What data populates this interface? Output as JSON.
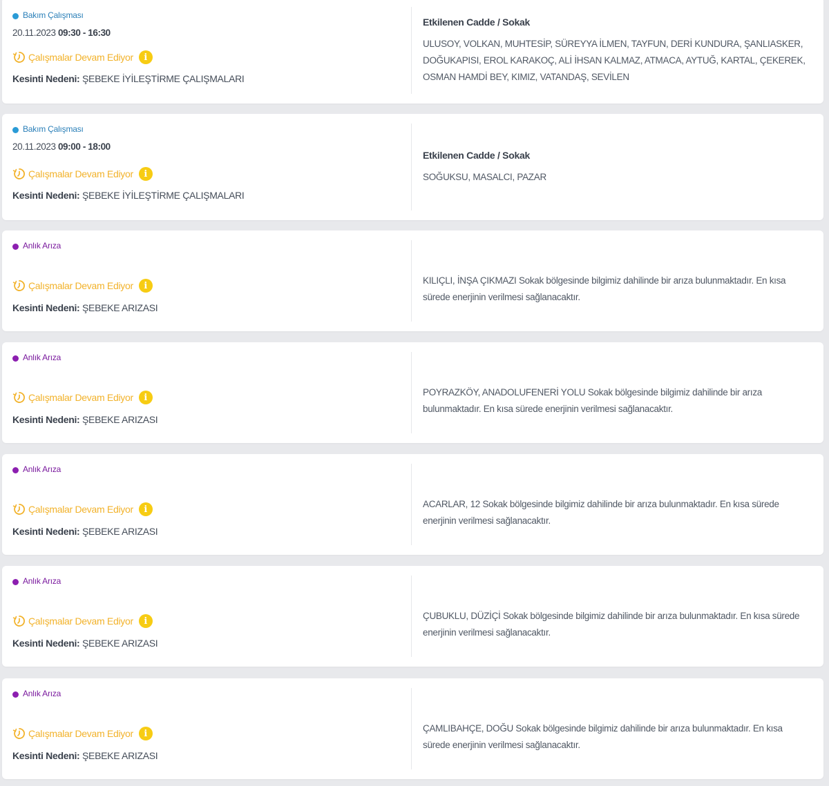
{
  "colors": {
    "maintenance_dot": "#2a9bd6",
    "maintenance_label": "#2a7fb8",
    "fault_dot": "#8c1fb0",
    "fault_label": "#7a1a9e",
    "status": "#f2b22a",
    "info": "#f7cc13"
  },
  "icons": {
    "status": "clock-refresh-icon",
    "info": "info-icon",
    "type_marker": "dot-icon"
  },
  "outages": [
    {
      "type": "Bakım Çalışması",
      "kind": "maintenance",
      "date": "20.11.2023",
      "time": "09:30 - 16:30",
      "status": "Çalışmalar Devam Ediyor",
      "info_glyph": "i",
      "reason_key": "Kesinti Nedeni:",
      "reason_value": "ŞEBEKE İYİLEŞTİRME ÇALIŞMALARI",
      "streets_heading": "Etkilenen Cadde / Sokak",
      "streets": "ULUSOY, VOLKAN, MUHTESİP, SÜREYYA İLMEN, TAYFUN, DERİ KUNDURA, ŞANLIASKER, DOĞUKAPISI, EROL KARAKOÇ, ALİ İHSAN KALMAZ, ATMACA, AYTUĞ, KARTAL, ÇEKEREK, OSMAN HAMDİ BEY, KIMIZ, VATANDAŞ, SEVİLEN"
    },
    {
      "type": "Bakım Çalışması",
      "kind": "maintenance",
      "date": "20.11.2023",
      "time": "09:00 - 18:00",
      "status": "Çalışmalar Devam Ediyor",
      "info_glyph": "i",
      "reason_key": "Kesinti Nedeni:",
      "reason_value": "ŞEBEKE İYİLEŞTİRME ÇALIŞMALARI",
      "streets_heading": "Etkilenen Cadde / Sokak",
      "streets": "SOĞUKSU, MASALCI, PAZAR"
    },
    {
      "type": "Anlık Arıza",
      "kind": "fault",
      "status": "Çalışmalar Devam Ediyor",
      "info_glyph": "i",
      "reason_key": "Kesinti Nedeni:",
      "reason_value": "ŞEBEKE ARIZASI",
      "streets": "KILIÇLI, İNŞA ÇIKMAZI Sokak bölgesinde bilgimiz dahilinde bir arıza bulunmaktadır. En kısa sürede enerjinin verilmesi sağlanacaktır."
    },
    {
      "type": "Anlık Arıza",
      "kind": "fault",
      "status": "Çalışmalar Devam Ediyor",
      "info_glyph": "i",
      "reason_key": "Kesinti Nedeni:",
      "reason_value": "ŞEBEKE ARIZASI",
      "streets": "POYRAZKÖY, ANADOLUFENERİ YOLU Sokak bölgesinde bilgimiz dahilinde bir arıza bulunmaktadır. En kısa sürede enerjinin verilmesi sağlanacaktır."
    },
    {
      "type": "Anlık Arıza",
      "kind": "fault",
      "status": "Çalışmalar Devam Ediyor",
      "info_glyph": "i",
      "reason_key": "Kesinti Nedeni:",
      "reason_value": "ŞEBEKE ARIZASI",
      "streets": "ACARLAR, 12 Sokak bölgesinde bilgimiz dahilinde bir arıza bulunmaktadır. En kısa sürede enerjinin verilmesi sağlanacaktır."
    },
    {
      "type": "Anlık Arıza",
      "kind": "fault",
      "status": "Çalışmalar Devam Ediyor",
      "info_glyph": "i",
      "reason_key": "Kesinti Nedeni:",
      "reason_value": "ŞEBEKE ARIZASI",
      "streets": "ÇUBUKLU, DÜZİÇİ Sokak bölgesinde bilgimiz dahilinde bir arıza bulunmaktadır. En kısa sürede enerjinin verilmesi sağlanacaktır."
    },
    {
      "type": "Anlık Arıza",
      "kind": "fault",
      "status": "Çalışmalar Devam Ediyor",
      "info_glyph": "i",
      "reason_key": "Kesinti Nedeni:",
      "reason_value": "ŞEBEKE ARIZASI",
      "streets": "ÇAMLIBAHÇE, DOĞU Sokak bölgesinde bilgimiz dahilinde bir arıza bulunmaktadır. En kısa sürede enerjinin verilmesi sağlanacaktır."
    }
  ]
}
